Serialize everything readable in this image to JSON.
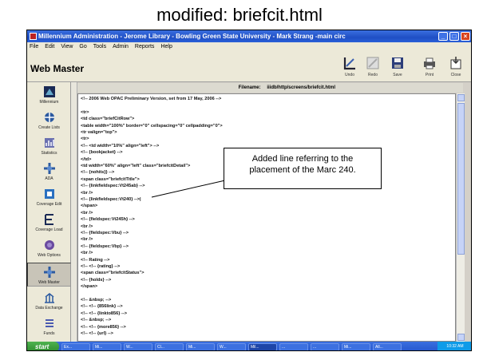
{
  "slide": {
    "title": "modified:  briefcit.html"
  },
  "window": {
    "title": "Millennium Administration - Jerome Library - Bowling Green State University - Mark Strang -main circ",
    "controls": [
      "_",
      "□",
      "×"
    ]
  },
  "menu": [
    "File",
    "Edit",
    "View",
    "Go",
    "Tools",
    "Admin",
    "Reports",
    "Help"
  ],
  "toolbar": {
    "app_name": "Web Master",
    "buttons": [
      {
        "label": "Undo",
        "icon": "undo-icon"
      },
      {
        "label": "Redo",
        "icon": "redo-icon"
      },
      {
        "label": "Save",
        "icon": "save-icon"
      },
      {
        "label": "Print",
        "icon": "print-icon"
      },
      {
        "label": "Close",
        "icon": "close-icon"
      }
    ]
  },
  "sidebar": {
    "items": [
      {
        "label": "Millennium",
        "icon": "millennium-icon"
      },
      {
        "label": "Create Lists",
        "icon": "create-lists-icon"
      },
      {
        "label": "Statistics",
        "icon": "statistics-icon"
      },
      {
        "label": "ADA",
        "icon": "ada-icon"
      },
      {
        "label": "Coverage Edit",
        "icon": "coverage-edit-icon"
      },
      {
        "label": "Coverage Load",
        "icon": "coverage-load-icon"
      },
      {
        "label": "Web Options",
        "icon": "web-options-icon"
      },
      {
        "label": "Web Master",
        "icon": "web-master-icon"
      },
      {
        "label": "Data Exchange",
        "icon": "data-exchange-icon"
      },
      {
        "label": "Funds",
        "icon": "funds-icon"
      }
    ]
  },
  "editor": {
    "filename_label": "Filename:",
    "filename_value": "iiidb/http/screens/briefcit.html",
    "lines": [
      "<!-- 2006 Web OPAC Preliminary Version, set from 17 May, 2006 -->",
      "",
      "<tr>",
      "<td class=\"briefCitRow\">",
      "<table width=\"100%\" border=\"0\" cellspacing=\"0\" cellpadding=\"0\">",
      "<tr valign=\"top\">",
      "<tr>",
      "<!-- <td width=\"10%\" align=\"left\"> -->",
      "<!-- {bookjacket} -->",
      "</td>",
      "<td width=\"60%\" align=\"left\" class=\"briefcitDetail\">",
      "<!-- {nohits}} -->",
      "<span class=\"briefcitTitle\">",
      "<!-- {linkfieldspec:Vt245ab} -->",
      "<br />",
      "<!-- {linkfieldspec:Vt240} -->|",
      "</span>",
      "<br />",
      "<!-- {fieldspec:Vt245h} -->",
      "<br />",
      "<!-- {fieldspec:Vbu} -->",
      "<br />",
      "<!-- {fieldspec:Vbp} -->",
      "<br />",
      "<!-- Rating -->",
      "<!-- <!-- {rating} -->",
      "<span class=\"briefcitStatus\">",
      "<!-- {holds} -->",
      "</span>",
      "",
      "<!-- &nbsp; -->",
      "<!-- <!-- {856link} -->",
      "<!-- <!-- {linkto856} -->",
      "<!-- &nbsp; -->",
      "<!-- <!-- {more856} -->",
      "<!-- <!-- {url} -->"
    ]
  },
  "callout": {
    "text_line1": "Added line referring to the",
    "text_line2": "placement of the Marc 240."
  },
  "taskbar": {
    "start_label": "start",
    "items": [
      "Ex...",
      "Mi...",
      "W...",
      "Cl...",
      "Mi...",
      "W...",
      "Mil...",
      "...",
      "...",
      "Mi...",
      "All...",
      "..."
    ],
    "tray": "10:32 AM"
  },
  "colors": {
    "titlebar": "#2a5fd8",
    "start": "#3a9a3a",
    "chrome": "#ece9d8"
  }
}
